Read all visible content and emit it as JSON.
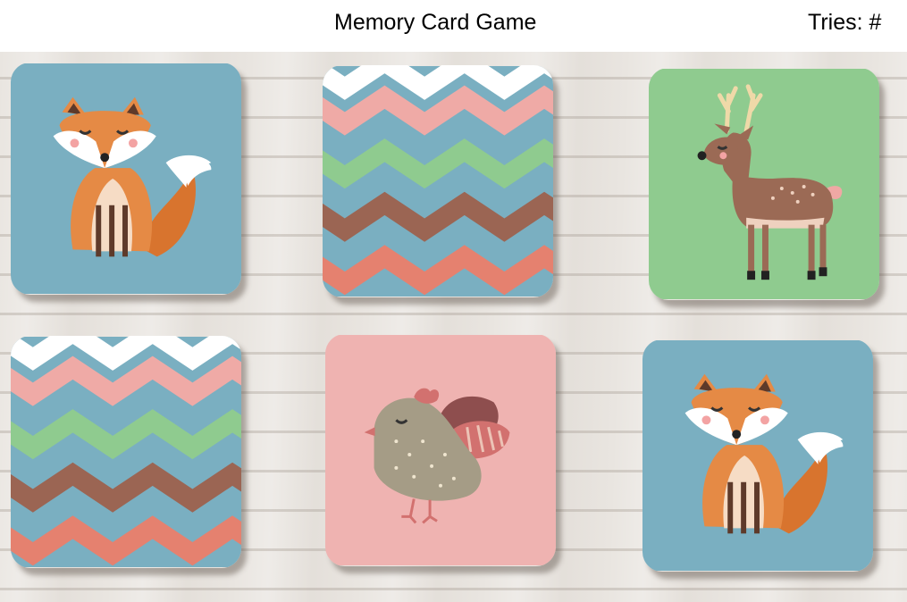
{
  "header": {
    "title": "Memory Card Game",
    "tries_label": "Tries: #"
  },
  "colors": {
    "blue_card": "#7aafc1",
    "green_card": "#8fcb8f",
    "pink_card": "#efb3b1",
    "fox_orange": "#e58a45",
    "deer_brown": "#9b6a55"
  },
  "cards": [
    {
      "face": "fox",
      "state": "revealed",
      "icon": "fox-icon"
    },
    {
      "face": "back",
      "state": "face-down",
      "icon": "chevron-pattern-icon"
    },
    {
      "face": "deer",
      "state": "revealed",
      "icon": "deer-icon"
    },
    {
      "face": "back",
      "state": "face-down",
      "icon": "chevron-pattern-icon"
    },
    {
      "face": "bird",
      "state": "revealed",
      "icon": "bird-icon"
    },
    {
      "face": "fox",
      "state": "revealed",
      "icon": "fox-icon"
    }
  ]
}
